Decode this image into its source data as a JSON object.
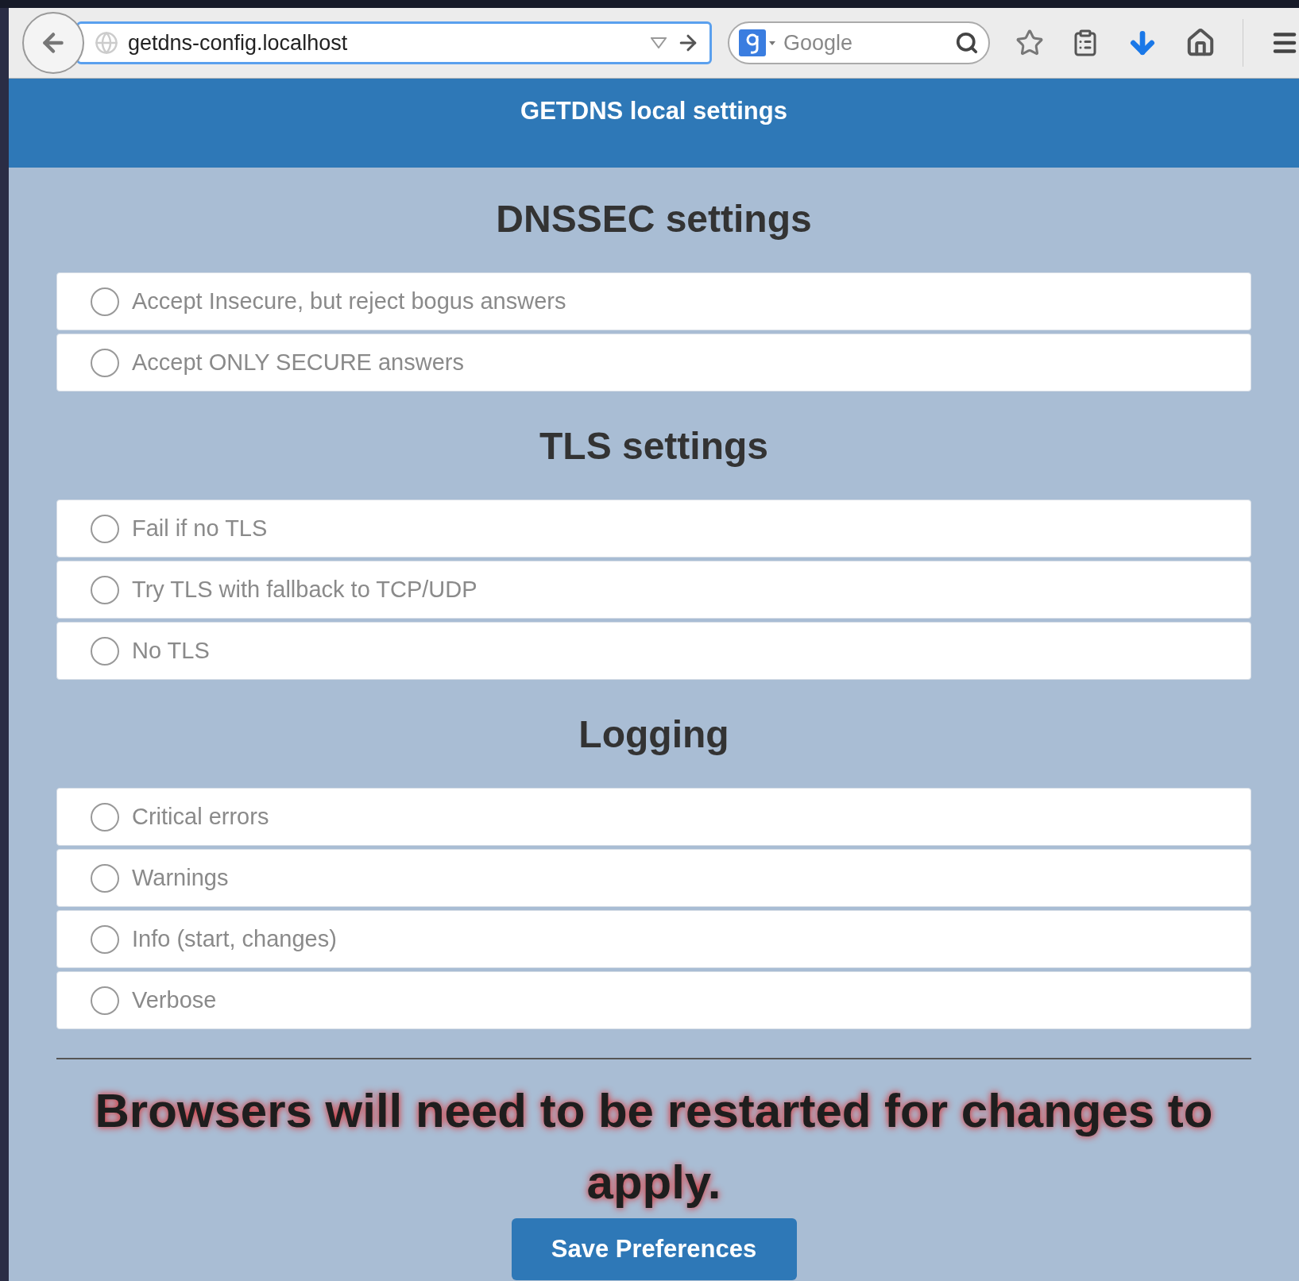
{
  "browser": {
    "url": "getdns-config.localhost",
    "search_placeholder": "Google"
  },
  "header": {
    "title": "GETDNS local settings"
  },
  "sections": [
    {
      "heading": "DNSSEC settings",
      "options": [
        {
          "label": "Accept Insecure, but reject bogus answers",
          "selected": false
        },
        {
          "label": "Accept ONLY SECURE answers",
          "selected": false
        }
      ]
    },
    {
      "heading": "TLS settings",
      "options": [
        {
          "label": "Fail if no TLS",
          "selected": false
        },
        {
          "label": "Try TLS with fallback to TCP/UDP",
          "selected": false
        },
        {
          "label": "No TLS",
          "selected": false
        }
      ]
    },
    {
      "heading": "Logging",
      "options": [
        {
          "label": "Critical errors",
          "selected": false
        },
        {
          "label": "Warnings",
          "selected": false
        },
        {
          "label": "Info (start, changes)",
          "selected": false
        },
        {
          "label": "Verbose",
          "selected": false
        }
      ]
    }
  ],
  "notice": "Browsers will need to be restarted for changes to apply.",
  "save_button": "Save Preferences"
}
